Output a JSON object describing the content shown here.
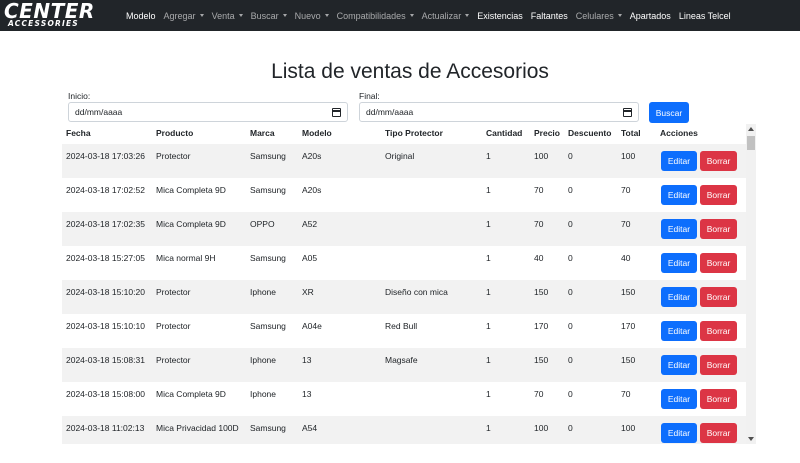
{
  "navbar": {
    "brand": "CENTER",
    "brand_sub": "ACCESSORIES",
    "items": [
      {
        "label": "Modelo",
        "dropdown": false,
        "active": true
      },
      {
        "label": "Agregar",
        "dropdown": true,
        "active": false
      },
      {
        "label": "Venta",
        "dropdown": true,
        "active": false
      },
      {
        "label": "Buscar",
        "dropdown": true,
        "active": false
      },
      {
        "label": "Nuevo",
        "dropdown": true,
        "active": false
      },
      {
        "label": "Compatibilidades",
        "dropdown": true,
        "active": false
      },
      {
        "label": "Actualizar",
        "dropdown": true,
        "active": false
      },
      {
        "label": "Existencias",
        "dropdown": false,
        "active": true
      },
      {
        "label": "Faltantes",
        "dropdown": false,
        "active": true
      },
      {
        "label": "Celulares",
        "dropdown": true,
        "active": false
      },
      {
        "label": "Apartados",
        "dropdown": false,
        "active": true
      },
      {
        "label": "Lineas Telcel",
        "dropdown": false,
        "active": true
      }
    ]
  },
  "page": {
    "title": "Lista de ventas de Accesorios"
  },
  "filters": {
    "start_label": "Inicio:",
    "start_placeholder": "dd/mm/aaaa",
    "end_label": "Final:",
    "end_placeholder": "dd/mm/aaaa",
    "search_button": "Buscar"
  },
  "table": {
    "headers": {
      "fecha": "Fecha",
      "producto": "Producto",
      "marca": "Marca",
      "modelo": "Modelo",
      "tipo": "Tipo Protector",
      "cantidad": "Cantidad",
      "precio": "Precio",
      "descuento": "Descuento",
      "total": "Total",
      "acciones": "Acciones"
    },
    "edit_label": "Editar",
    "delete_label": "Borrar",
    "rows": [
      {
        "fecha": "2024-03-18 17:03:26",
        "producto": "Protector",
        "marca": "Samsung",
        "modelo": "A20s",
        "tipo": "Original",
        "cantidad": "1",
        "precio": "100",
        "descuento": "0",
        "total": "100"
      },
      {
        "fecha": "2024-03-18 17:02:52",
        "producto": "Mica Completa 9D",
        "marca": "Samsung",
        "modelo": "A20s",
        "tipo": "",
        "cantidad": "1",
        "precio": "70",
        "descuento": "0",
        "total": "70"
      },
      {
        "fecha": "2024-03-18 17:02:35",
        "producto": "Mica Completa 9D",
        "marca": "OPPO",
        "modelo": "A52",
        "tipo": "",
        "cantidad": "1",
        "precio": "70",
        "descuento": "0",
        "total": "70"
      },
      {
        "fecha": "2024-03-18 15:27:05",
        "producto": "Mica normal 9H",
        "marca": "Samsung",
        "modelo": "A05",
        "tipo": "",
        "cantidad": "1",
        "precio": "40",
        "descuento": "0",
        "total": "40"
      },
      {
        "fecha": "2024-03-18 15:10:20",
        "producto": "Protector",
        "marca": "Iphone",
        "modelo": "XR",
        "tipo": "Diseño con mica",
        "cantidad": "1",
        "precio": "150",
        "descuento": "0",
        "total": "150"
      },
      {
        "fecha": "2024-03-18 15:10:10",
        "producto": "Protector",
        "marca": "Samsung",
        "modelo": "A04e",
        "tipo": "Red Bull",
        "cantidad": "1",
        "precio": "170",
        "descuento": "0",
        "total": "170"
      },
      {
        "fecha": "2024-03-18 15:08:31",
        "producto": "Protector",
        "marca": "Iphone",
        "modelo": "13",
        "tipo": "Magsafe",
        "cantidad": "1",
        "precio": "150",
        "descuento": "0",
        "total": "150"
      },
      {
        "fecha": "2024-03-18 15:08:00",
        "producto": "Mica Completa 9D",
        "marca": "Iphone",
        "modelo": "13",
        "tipo": "",
        "cantidad": "1",
        "precio": "70",
        "descuento": "0",
        "total": "70"
      },
      {
        "fecha": "2024-03-18 11:02:13",
        "producto": "Mica Privacidad 100D",
        "marca": "Samsung",
        "modelo": "A54",
        "tipo": "",
        "cantidad": "1",
        "precio": "100",
        "descuento": "0",
        "total": "100"
      }
    ]
  },
  "colors": {
    "navbar_bg": "#212529",
    "primary": "#0d6efd",
    "danger": "#dc3545",
    "stripe": "#f2f2f2"
  }
}
